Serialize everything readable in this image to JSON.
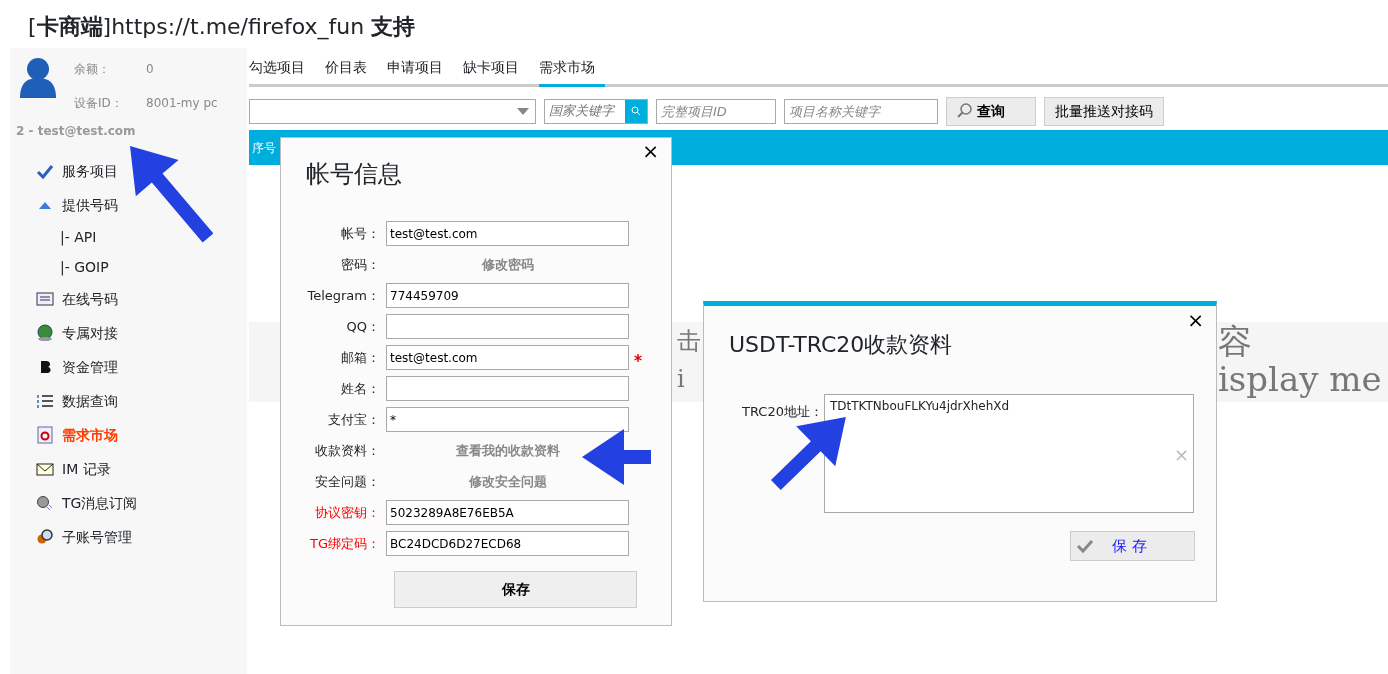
{
  "title": "[**卡商端**]https://t.me/firefox_fun **支持**",
  "sidebar": {
    "balance_label": "余额：",
    "balance": "0",
    "device_label": "设备ID：",
    "device": "8001-my pc",
    "account": "2 - test@test.com",
    "items": [
      {
        "label": "服务项目",
        "selected": false
      },
      {
        "label": "提供号码",
        "selected": false,
        "children": [
          {
            "label": "|- API"
          },
          {
            "label": "|- GOIP"
          }
        ]
      },
      {
        "label": "在线号码",
        "selected": false
      },
      {
        "label": "专属对接",
        "selected": false
      },
      {
        "label": "资金管理",
        "selected": false
      },
      {
        "label": "数据查询",
        "selected": false
      },
      {
        "label": "需求市场",
        "selected": true
      },
      {
        "label": "IM 记录",
        "selected": false
      },
      {
        "label": "TG消息订阅",
        "selected": false
      },
      {
        "label": "子账号管理",
        "selected": false
      }
    ]
  },
  "tabs": [
    {
      "label": "勾选项目",
      "selected": false
    },
    {
      "label": "价目表",
      "selected": false
    },
    {
      "label": "申请项目",
      "selected": false
    },
    {
      "label": "缺卡项目",
      "selected": false
    },
    {
      "label": "需求市场",
      "selected": true
    }
  ],
  "filters": {
    "country": {
      "placeholder": "国家关键字"
    },
    "project_id": {
      "placeholder": "完整项目ID"
    },
    "project_name": {
      "placeholder": "项目名称关键字"
    },
    "query_button": "查询",
    "push_button": "批量推送对接码"
  },
  "table": {
    "columns": [
      "序号"
    ]
  },
  "background_text": {
    "left": [
      "击",
      "i"
    ],
    "right": [
      "容",
      "isplay me"
    ]
  },
  "account_dialog": {
    "title": "帐号信息",
    "close": "×",
    "fields": [
      {
        "kind": "input",
        "label": "帐号：",
        "value": "test@test.com"
      },
      {
        "kind": "link",
        "label": "密码：",
        "link": "修改密码"
      },
      {
        "kind": "input",
        "label": "Telegram：",
        "value": "774459709"
      },
      {
        "kind": "input",
        "label": "QQ："
      },
      {
        "kind": "input",
        "label": "邮箱：",
        "value": "test@test.com",
        "required": true
      },
      {
        "kind": "input",
        "label": "姓名："
      },
      {
        "kind": "input",
        "label": "支付宝：",
        "value": "*"
      },
      {
        "kind": "link",
        "label": "收款资料：",
        "link": "查看我的收款资料"
      },
      {
        "kind": "link",
        "label": "安全问题：",
        "link": "修改安全问题"
      },
      {
        "kind": "input",
        "label": "协议密钥：",
        "value": "5023289A8E76EB5A",
        "warning": true
      },
      {
        "kind": "input",
        "label": "TG绑定码：",
        "value": "BC24DCD6D27ECD68",
        "warning": true
      }
    ],
    "save": "保存"
  },
  "payment_dialog": {
    "title": "USDT-TRC20收款资料",
    "close": "×",
    "label": "TRC20地址：",
    "value": "TDtTKTNbouFLKYu4jdrXhehXd",
    "clear": "×",
    "save": "保 存"
  }
}
